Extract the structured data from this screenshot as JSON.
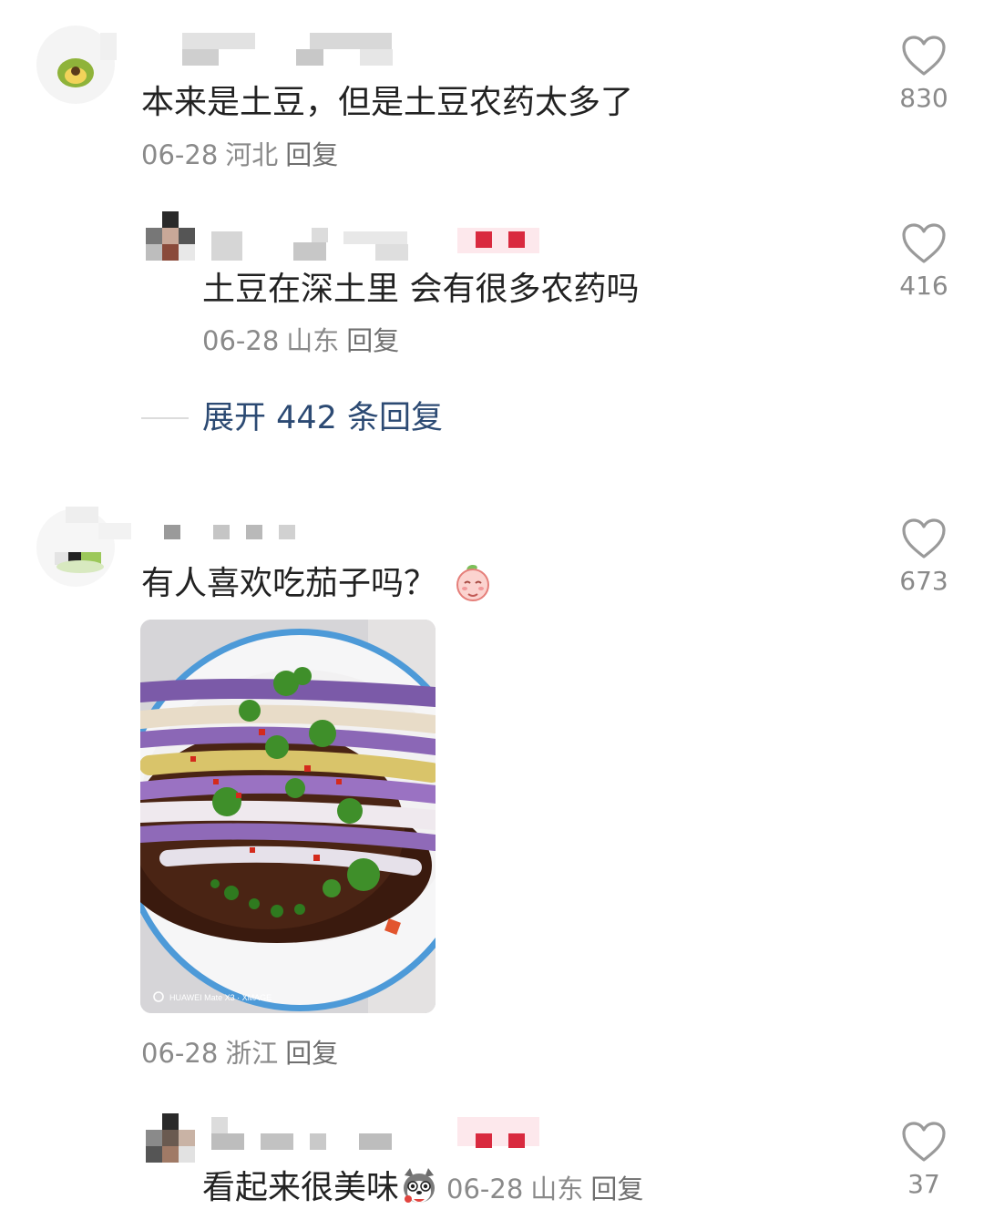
{
  "comments": [
    {
      "text": "本来是土豆，但是土豆农药太多了",
      "date": "06-28",
      "location": "河北",
      "reply_label": "回复",
      "likes": "830"
    },
    {
      "text": "土豆在深土里 会有很多农药吗",
      "date": "06-28",
      "location": "山东",
      "reply_label": "回复",
      "likes": "416"
    },
    {
      "text": "有人喜欢吃茄子吗？",
      "date": "06-28",
      "location": "浙江",
      "reply_label": "回复",
      "likes": "673",
      "photo_watermark": "HUAWEI Mate X3 · XMAGE"
    },
    {
      "text": "看起来很美味",
      "date": "06-28",
      "location": "山东",
      "reply_label": "回复",
      "likes": "37"
    }
  ],
  "expand_replies": "展开 442 条回复",
  "colors": {
    "link": "#2c4a73",
    "meta": "#8a8a8a",
    "heart": "#9a9a9a"
  },
  "icons": {
    "like": "heart-outline-icon",
    "emoji_peach": "peach-face-emoji",
    "emoji_dog": "husky-dog-emoji"
  }
}
